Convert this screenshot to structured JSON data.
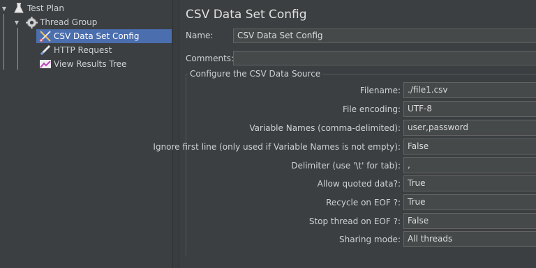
{
  "tree": {
    "items": [
      {
        "label": "Test Plan"
      },
      {
        "label": "Thread Group"
      },
      {
        "label": "CSV Data Set Config"
      },
      {
        "label": "HTTP Request"
      },
      {
        "label": "View Results Tree"
      }
    ]
  },
  "panel": {
    "title": "CSV Data Set Config",
    "name_label": "Name:",
    "name_value": "CSV Data Set Config",
    "comments_label": "Comments:",
    "comments_value": "",
    "group_title": "Configure the CSV Data Source",
    "rows": [
      {
        "label": "Filename:",
        "value": "./file1.csv"
      },
      {
        "label": "File encoding:",
        "value": "UTF-8"
      },
      {
        "label": "Variable Names (comma-delimited):",
        "value": "user,password"
      },
      {
        "label": "Ignore first line (only used if Variable Names is not empty):",
        "value": "False"
      },
      {
        "label": "Delimiter (use '\\t' for tab):",
        "value": ","
      },
      {
        "label": "Allow quoted data?:",
        "value": "True"
      },
      {
        "label": "Recycle on EOF ?:",
        "value": "True"
      },
      {
        "label": "Stop thread on EOF ?:",
        "value": "False"
      },
      {
        "label": "Sharing mode:",
        "value": "All threads"
      }
    ]
  }
}
